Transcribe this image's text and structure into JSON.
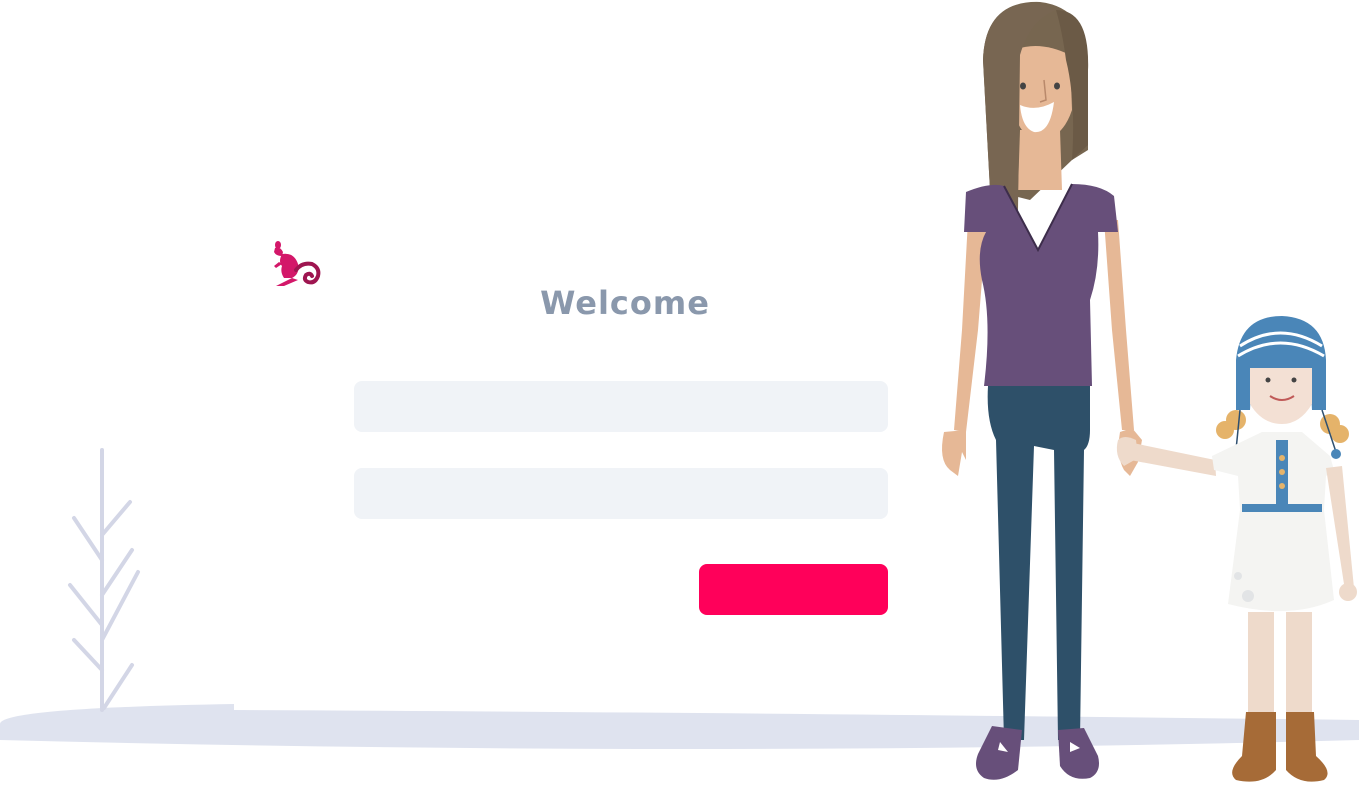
{
  "login": {
    "title": "Welcome",
    "username_placeholder": "",
    "username_value": "",
    "password_placeholder": "",
    "password_value": "",
    "submit_label": ""
  },
  "colors": {
    "accent": "#ff005a",
    "title": "#8a98ac",
    "field_bg": "#f0f3f7",
    "ground": "#dfe3ef",
    "logo": "#d31769"
  },
  "icons": {
    "logo": "kangaroo-logo-icon"
  }
}
